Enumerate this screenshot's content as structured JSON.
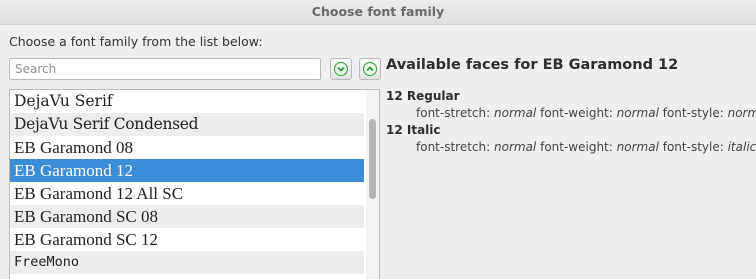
{
  "window": {
    "title": "Choose font family"
  },
  "prompt": "Choose a font family from the list below:",
  "search": {
    "placeholder": "Search",
    "value": ""
  },
  "nav": {
    "down_icon": "chevron-down-icon",
    "up_icon": "chevron-up-icon",
    "accent": "#2f9d3e"
  },
  "fonts": [
    "DejaVu Serif",
    "DejaVu Serif Condensed",
    "EB Garamond 08",
    "EB Garamond 12",
    "EB Garamond 12 All SC",
    "EB Garamond SC 08",
    "EB Garamond SC 12",
    "FreeMono"
  ],
  "selected_index": 3,
  "selection_color": "#3b8dd8",
  "faces": {
    "heading": "Available faces for EB Garamond 12",
    "stretch_label": "font-stretch:",
    "weight_label": "font-weight:",
    "style_label": "font-style:",
    "items": [
      {
        "name": "12 Regular",
        "stretch": "normal",
        "weight": "normal",
        "style": "normal"
      },
      {
        "name": "12 Italic",
        "stretch": "normal",
        "weight": "normal",
        "style": "italic"
      }
    ]
  }
}
